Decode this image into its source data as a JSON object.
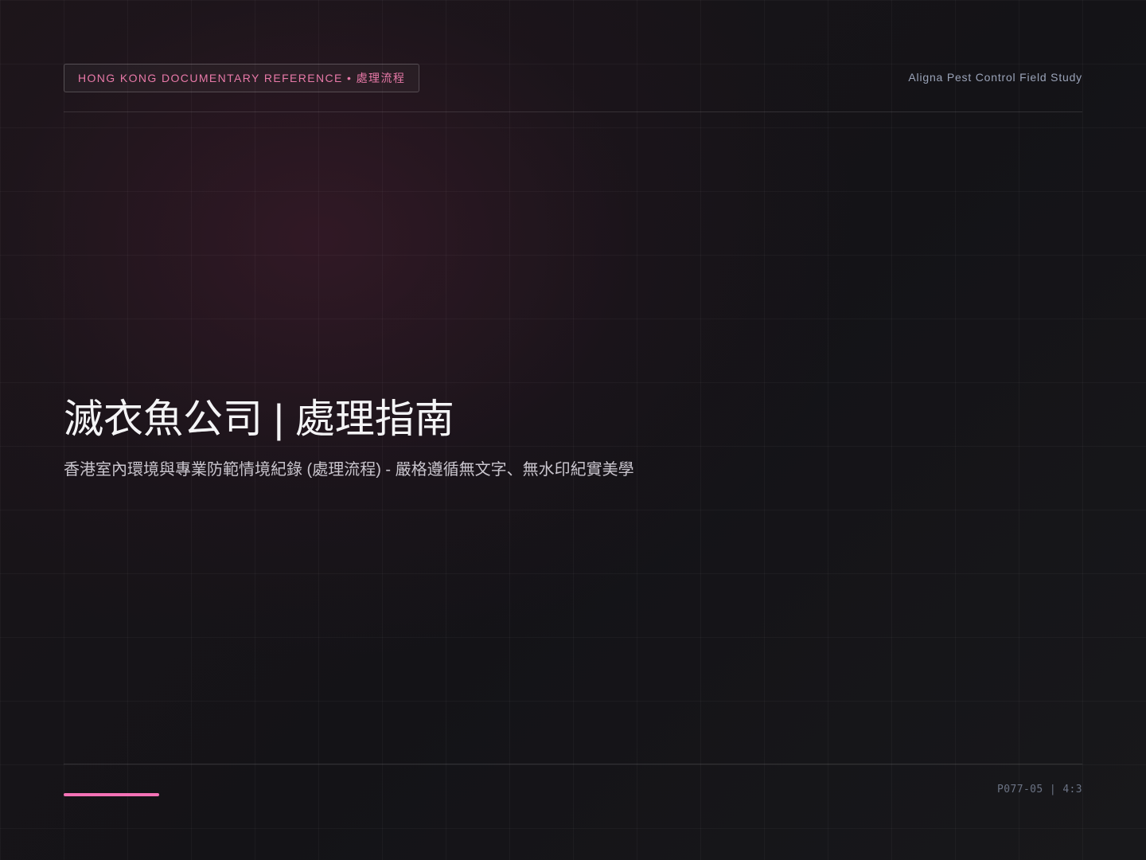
{
  "header": {
    "tag": "HONG KONG DOCUMENTARY REFERENCE • 處理流程",
    "study_label": "Aligna Pest Control Field Study"
  },
  "main": {
    "title": "滅衣魚公司 | 處理指南",
    "subtitle": "香港室內環境與專業防範情境紀錄 (處理流程) - 嚴格遵循無文字、無水印紀實美學"
  },
  "footer": {
    "code": "P077-05 | 4:3"
  },
  "colors": {
    "accent": "#f472b6",
    "tag_text": "#e879a8",
    "background": "#141317"
  }
}
